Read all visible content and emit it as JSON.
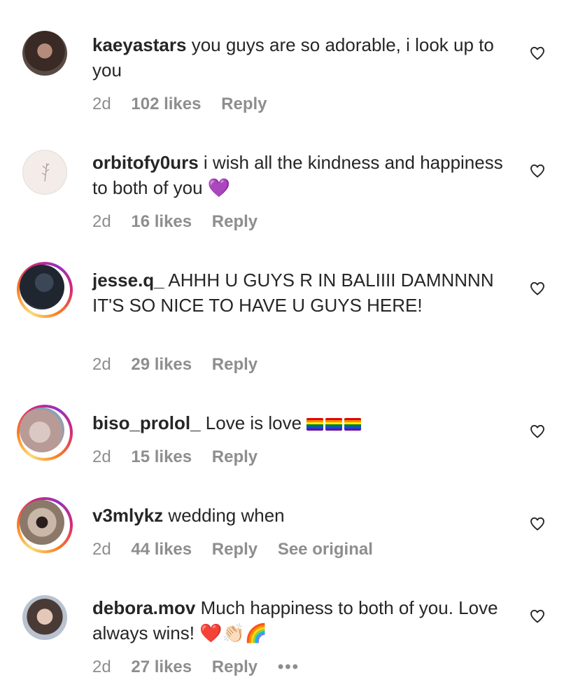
{
  "comments": [
    {
      "username": "kaeyastars",
      "text": " you guys are so adorable, i look up to you",
      "age": "2d",
      "likes": "102 likes",
      "reply": "Reply"
    },
    {
      "username": "orbitofy0urs",
      "text": " i wish all the kindness and happiness to both of you 💜",
      "age": "2d",
      "likes": "16 likes",
      "reply": "Reply"
    },
    {
      "username": "jesse.q_",
      "text": " AHHH U GUYS R IN BALIIII DAMNNNN IT'S SO NICE TO HAVE U GUYS HERE!",
      "age": "2d",
      "likes": "29 likes",
      "reply": "Reply"
    },
    {
      "username": "biso_prolol_",
      "text": " Love is love ",
      "age": "2d",
      "likes": "15 likes",
      "reply": "Reply"
    },
    {
      "username": "v3mlykz",
      "text": " wedding when",
      "age": "2d",
      "likes": "44 likes",
      "reply": "Reply",
      "see_original": "See original"
    },
    {
      "username": "debora.mov",
      "text": " Much happiness to both of you. Love always wins! ❤️👏🏻🌈",
      "age": "2d",
      "likes": "27 likes",
      "reply": "Reply",
      "more": "•••"
    }
  ],
  "colors": {
    "text": "#262626",
    "secondary": "#8e8e8e",
    "story_ring": [
      "#feda75",
      "#fa7e1e",
      "#d62976",
      "#962fbf"
    ]
  },
  "icons": {
    "like": "heart-outline-icon"
  }
}
